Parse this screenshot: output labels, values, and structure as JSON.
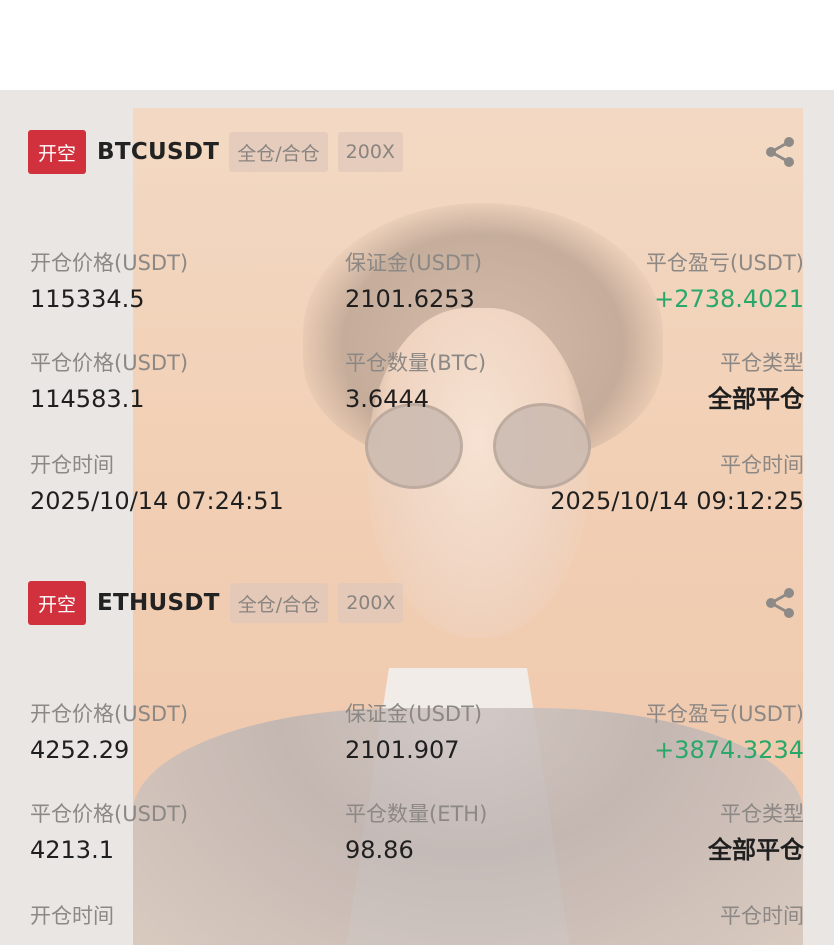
{
  "positions": [
    {
      "side_tag": "开空",
      "symbol": "BTCUSDT",
      "margin_mode": "全仓/合仓",
      "leverage": "200X",
      "open_price_label": "开仓价格(USDT)",
      "open_price": "115334.5",
      "margin_label": "保证金(USDT)",
      "margin": "2101.6253",
      "pnl_label": "平仓盈亏(USDT)",
      "pnl": "+2738.4021",
      "close_price_label": "平仓价格(USDT)",
      "close_price": "114583.1",
      "close_qty_label": "平仓数量(BTC)",
      "close_qty": "3.6444",
      "close_type_label": "平仓类型",
      "close_type": "全部平仓",
      "open_time_label": "开仓时间",
      "open_time": "2025/10/14 07:24:51",
      "close_time_label": "平仓时间",
      "close_time": "2025/10/14 09:12:25"
    },
    {
      "side_tag": "开空",
      "symbol": "ETHUSDT",
      "margin_mode": "全仓/合仓",
      "leverage": "200X",
      "open_price_label": "开仓价格(USDT)",
      "open_price": "4252.29",
      "margin_label": "保证金(USDT)",
      "margin": "2101.907",
      "pnl_label": "平仓盈亏(USDT)",
      "pnl": "+3874.3234",
      "close_price_label": "平仓价格(USDT)",
      "close_price": "4213.1",
      "close_qty_label": "平仓数量(ETH)",
      "close_qty": "98.86",
      "close_type_label": "平仓类型",
      "close_type": "全部平仓",
      "open_time_label": "开仓时间",
      "close_time_label": "平仓时间"
    }
  ],
  "colors": {
    "tag_red": "#d0313d",
    "profit_green": "#2aa86a"
  },
  "icons": {
    "share": "share-icon"
  }
}
